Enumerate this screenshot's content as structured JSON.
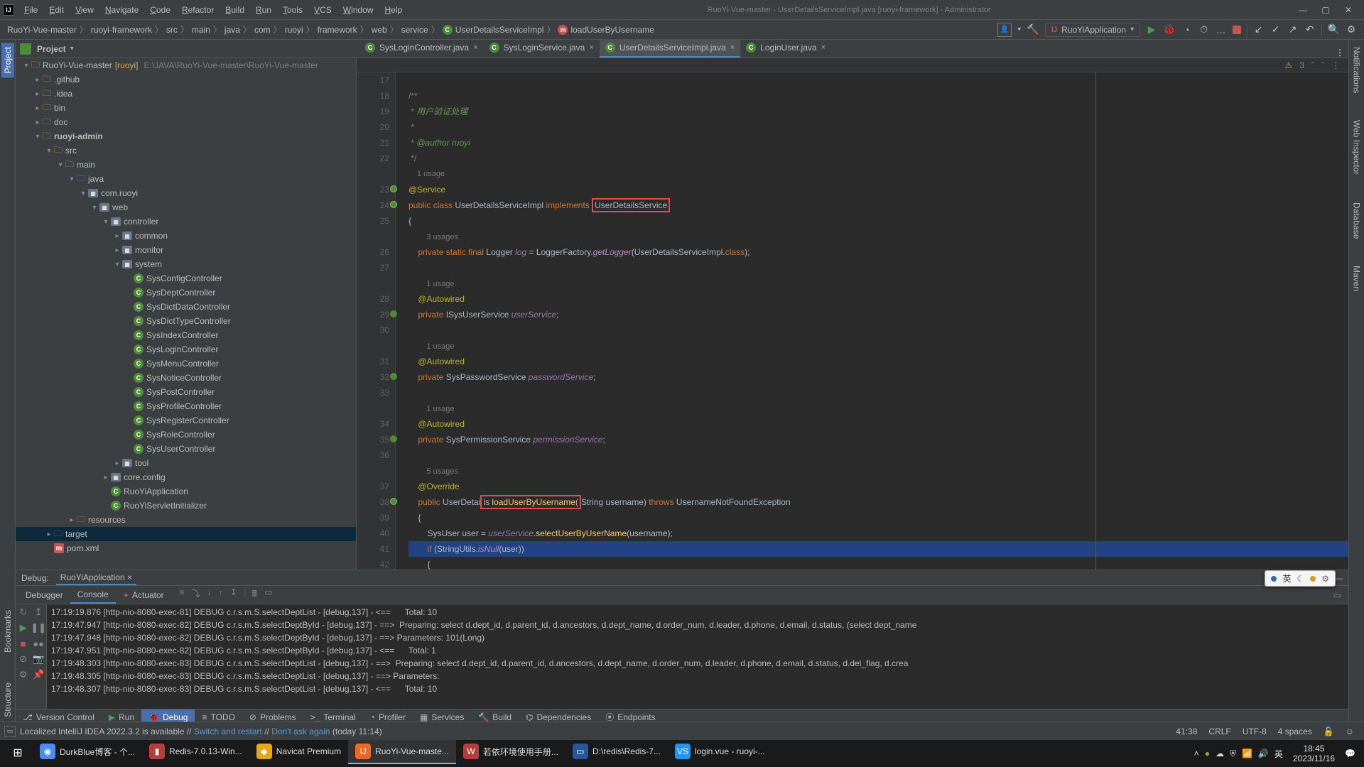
{
  "menu": {
    "items": [
      "File",
      "Edit",
      "View",
      "Navigate",
      "Code",
      "Refactor",
      "Build",
      "Run",
      "Tools",
      "VCS",
      "Window",
      "Help"
    ],
    "title_path": "RuoYi-Vue-master - UserDetailsServiceImpl.java [ruoyi-framework] - Administrator"
  },
  "breadcrumbs": [
    "RuoYi-Vue-master",
    "ruoyi-framework",
    "src",
    "main",
    "java",
    "com",
    "ruoyi",
    "framework",
    "web",
    "service",
    "UserDetailsServiceImpl",
    "loadUserByUsername"
  ],
  "run_config": "RuoYiApplication",
  "project_header": {
    "title": "Project"
  },
  "tree": [
    {
      "indent": 0,
      "arrow": "▾",
      "icon": "folder",
      "label": "RuoYi-Vue-master",
      "suffix": "[ruoyi]",
      "path": "E:\\JAVA\\RuoYi-Vue-master\\RuoYi-Vue-master"
    },
    {
      "indent": 1,
      "arrow": "▸",
      "icon": "folder",
      "label": ".github"
    },
    {
      "indent": 1,
      "arrow": "▸",
      "icon": "folder",
      "label": ".idea"
    },
    {
      "indent": 1,
      "arrow": "▸",
      "icon": "folder",
      "label": "bin"
    },
    {
      "indent": 1,
      "arrow": "▸",
      "icon": "folder",
      "label": "doc"
    },
    {
      "indent": 1,
      "arrow": "▾",
      "icon": "folder",
      "label": "ruoyi-admin",
      "bold": true
    },
    {
      "indent": 2,
      "arrow": "▾",
      "icon": "folder",
      "label": "src"
    },
    {
      "indent": 3,
      "arrow": "▾",
      "icon": "folder",
      "label": "main"
    },
    {
      "indent": 4,
      "arrow": "▾",
      "icon": "folder-blue",
      "label": "java"
    },
    {
      "indent": 5,
      "arrow": "▾",
      "icon": "pkg",
      "label": "com.ruoyi"
    },
    {
      "indent": 6,
      "arrow": "▾",
      "icon": "pkg",
      "label": "web"
    },
    {
      "indent": 7,
      "arrow": "▾",
      "icon": "pkg",
      "label": "controller"
    },
    {
      "indent": 8,
      "arrow": "▸",
      "icon": "pkg",
      "label": "common"
    },
    {
      "indent": 8,
      "arrow": "▸",
      "icon": "pkg",
      "label": "monitor"
    },
    {
      "indent": 8,
      "arrow": "▾",
      "icon": "pkg",
      "label": "system"
    },
    {
      "indent": 9,
      "arrow": "",
      "icon": "class",
      "label": "SysConfigController"
    },
    {
      "indent": 9,
      "arrow": "",
      "icon": "class",
      "label": "SysDeptController"
    },
    {
      "indent": 9,
      "arrow": "",
      "icon": "class",
      "label": "SysDictDataController"
    },
    {
      "indent": 9,
      "arrow": "",
      "icon": "class",
      "label": "SysDictTypeController"
    },
    {
      "indent": 9,
      "arrow": "",
      "icon": "class",
      "label": "SysIndexController"
    },
    {
      "indent": 9,
      "arrow": "",
      "icon": "class",
      "label": "SysLoginController"
    },
    {
      "indent": 9,
      "arrow": "",
      "icon": "class",
      "label": "SysMenuController"
    },
    {
      "indent": 9,
      "arrow": "",
      "icon": "class",
      "label": "SysNoticeController"
    },
    {
      "indent": 9,
      "arrow": "",
      "icon": "class",
      "label": "SysPostController"
    },
    {
      "indent": 9,
      "arrow": "",
      "icon": "class",
      "label": "SysProfileController"
    },
    {
      "indent": 9,
      "arrow": "",
      "icon": "class",
      "label": "SysRegisterController"
    },
    {
      "indent": 9,
      "arrow": "",
      "icon": "class",
      "label": "SysRoleController"
    },
    {
      "indent": 9,
      "arrow": "",
      "icon": "class",
      "label": "SysUserController"
    },
    {
      "indent": 8,
      "arrow": "▸",
      "icon": "pkg",
      "label": "tool"
    },
    {
      "indent": 7,
      "arrow": "▸",
      "icon": "pkg",
      "label": "core.config"
    },
    {
      "indent": 7,
      "arrow": "",
      "icon": "class",
      "label": "RuoYiApplication"
    },
    {
      "indent": 7,
      "arrow": "",
      "icon": "class",
      "label": "RuoYiServletInitializer"
    },
    {
      "indent": 4,
      "arrow": "▸",
      "icon": "folder",
      "label": "resources"
    },
    {
      "indent": 2,
      "arrow": "▸",
      "icon": "folder-red",
      "label": "target",
      "selected": true
    },
    {
      "indent": 2,
      "arrow": "",
      "icon": "m",
      "label": "pom.xml"
    }
  ],
  "tabs": [
    {
      "label": "SysLoginController.java",
      "active": false
    },
    {
      "label": "SysLoginService.java",
      "active": false
    },
    {
      "label": "UserDetailsServiceImpl.java",
      "active": true
    },
    {
      "label": "LoginUser.java",
      "active": false
    }
  ],
  "editor_status": {
    "warnings": "3",
    "marker": "^",
    "caret_up": "ˆ",
    "caret_down": "ˇ"
  },
  "code_lines": [
    {
      "n": 17,
      "html": ""
    },
    {
      "n": 18,
      "html": "<span class='comment'>/**</span>"
    },
    {
      "n": 19,
      "html": "<span class='comment'> * <span class='doc'>用户验证处理</span></span>"
    },
    {
      "n": 20,
      "html": "<span class='comment'> *</span>"
    },
    {
      "n": 21,
      "html": "<span class='comment'> * <span class='doc'>@author</span> <span class='doc'>ruoyi</span></span>"
    },
    {
      "n": 22,
      "html": "<span class='comment'> */</span>"
    },
    {
      "n": "",
      "html": "<span class='usage-hint'>1 usage</span>"
    },
    {
      "n": 23,
      "html": "<span class='ann'>@Service</span>",
      "mark": "impl"
    },
    {
      "n": 24,
      "html": "<span class='kw'>public class</span> <span class='type'>UserDetailsServiceImpl</span> <span class='kw'>implements</span> <span class='redbox'><span class='type'>UserDetailsService</span></span>",
      "mark": "impl"
    },
    {
      "n": 25,
      "html": "<span class='ident'>{</span>"
    },
    {
      "n": "",
      "html": "    <span class='usage-hint'>3 usages</span>"
    },
    {
      "n": 26,
      "html": "    <span class='kw'>private static final</span> <span class='type'>Logger</span> <span class='field'>log</span> = <span class='type'>LoggerFactory</span>.<span class='static-method'>getLogger</span>(<span class='type'>UserDetailsServiceImpl</span>.<span class='kw'>class</span>);"
    },
    {
      "n": 27,
      "html": ""
    },
    {
      "n": "",
      "html": "    <span class='usage-hint'>1 usage</span>"
    },
    {
      "n": 28,
      "html": "    <span class='ann'>@Autowired</span>"
    },
    {
      "n": 29,
      "html": "    <span class='kw'>private</span> <span class='type'>ISysUserService</span> <span class='field'>userService</span>;",
      "mark": "green"
    },
    {
      "n": 30,
      "html": ""
    },
    {
      "n": "",
      "html": "    <span class='usage-hint'>1 usage</span>"
    },
    {
      "n": 31,
      "html": "    <span class='ann'>@Autowired</span>"
    },
    {
      "n": 32,
      "html": "    <span class='kw'>private</span> <span class='type'>SysPasswordService</span> <span class='field'>passwordService</span>;",
      "mark": "green"
    },
    {
      "n": 33,
      "html": ""
    },
    {
      "n": "",
      "html": "    <span class='usage-hint'>1 usage</span>"
    },
    {
      "n": 34,
      "html": "    <span class='ann'>@Autowired</span>"
    },
    {
      "n": 35,
      "html": "    <span class='kw'>private</span> <span class='type'>SysPermissionService</span> <span class='field'>permissionService</span>;",
      "mark": "green"
    },
    {
      "n": 36,
      "html": ""
    },
    {
      "n": "",
      "html": "    <span class='usage-hint'>5 usages</span>"
    },
    {
      "n": 37,
      "html": "    <span class='ann'>@Override</span>"
    },
    {
      "n": 38,
      "html": "    <span class='kw'>public</span> <span class='type'>UserDetai</span><span class='redbox'><span class='type'>ls</span> <span class='method'>loadUserByUsername</span>(</span><span class='type'>String</span> <span class='ident'>username)</span> <span class='kw'>throws</span> <span class='type'>UsernameNotFoundException</span>",
      "mark": "impl"
    },
    {
      "n": 39,
      "html": "    <span class='ident'>{</span>"
    },
    {
      "n": 40,
      "html": "        <span class='type'>SysUser</span> <span class='ident'>user</span> = <span class='field'>userService</span>.<span class='method'>selectUserByUserName</span>(username);"
    },
    {
      "n": 41,
      "html": "        <span class='kw'>if</span> (<span class='type'>StringUtils</span>.<span class='static-method'>isNull</span>(user))",
      "current": true
    },
    {
      "n": 42,
      "html": "        <span class='ident'>{</span>"
    }
  ],
  "debug": {
    "title": "Debug:",
    "active_tab": "RuoYiApplication",
    "subtabs": [
      "Debugger",
      "Console",
      "Actuator"
    ],
    "active_subtab": "Console",
    "logs": [
      "17:19:19.876 [http-nio-8080-exec-81] DEBUG c.r.s.m.S.selectDeptList - [debug,137] - <==      Total: 10",
      "17:19:47.947 [http-nio-8080-exec-82] DEBUG c.r.s.m.S.selectDeptById - [debug,137] - ==>  Preparing: select d.dept_id, d.parent_id, d.ancestors, d.dept_name, d.order_num, d.leader, d.phone, d.email, d.status, (select dept_name",
      "17:19:47.948 [http-nio-8080-exec-82] DEBUG c.r.s.m.S.selectDeptById - [debug,137] - ==> Parameters: 101(Long)",
      "17:19:47.951 [http-nio-8080-exec-82] DEBUG c.r.s.m.S.selectDeptById - [debug,137] - <==      Total: 1",
      "17:19:48.303 [http-nio-8080-exec-83] DEBUG c.r.s.m.S.selectDeptList - [debug,137] - ==>  Preparing: select d.dept_id, d.parent_id, d.ancestors, d.dept_name, d.order_num, d.leader, d.phone, d.email, d.status, d.del_flag, d.crea",
      "17:19:48.305 [http-nio-8080-exec-83] DEBUG c.r.s.m.S.selectDeptList - [debug,137] - ==> Parameters:",
      "17:19:48.307 [http-nio-8080-exec-83] DEBUG c.r.s.m.S.selectDeptList - [debug,137] - <==      Total: 10"
    ]
  },
  "bottom_tools": [
    {
      "label": "Version Control",
      "icon": "⎇"
    },
    {
      "label": "Run",
      "icon": "▶",
      "iconcls": "green"
    },
    {
      "label": "Debug",
      "icon": "🐞",
      "active": true
    },
    {
      "label": "TODO",
      "icon": "≡"
    },
    {
      "label": "Problems",
      "icon": "⊘"
    },
    {
      "label": "Terminal",
      "icon": ">_"
    },
    {
      "label": "Profiler",
      "icon": "◔"
    },
    {
      "label": "Services",
      "icon": "▦"
    },
    {
      "label": "Build",
      "icon": "🔨"
    },
    {
      "label": "Dependencies",
      "icon": "⌬"
    },
    {
      "label": "Endpoints",
      "icon": "⦿"
    }
  ],
  "status": {
    "message_prefix": "Localized IntelliJ IDEA 2022.3.2 is available // ",
    "link1": "Switch and restart",
    "sep": " // ",
    "link2": "Don't ask again",
    "suffix": " (today 11:14)",
    "caret": "41:38",
    "eol": "CRLF",
    "encoding": "UTF-8",
    "indent": "4 spaces"
  },
  "overlay": {
    "lang": "英"
  },
  "taskbar": {
    "items": [
      {
        "label": "",
        "icon": "⊞",
        "cls": "start"
      },
      {
        "label": "DurkBlue博客 - 个...",
        "iconbg": "#4c8bf5",
        "icontext": "◉"
      },
      {
        "label": "Redis-7.0.13-Win...",
        "iconbg": "#b93c3c",
        "icontext": "▮"
      },
      {
        "label": "Navicat Premium",
        "iconbg": "#e6a817",
        "icontext": "◆"
      },
      {
        "label": "RuoYi-Vue-maste...",
        "iconbg": "#f26522",
        "icontext": "IJ",
        "active": true
      },
      {
        "label": "若依环境使用手册...",
        "iconbg": "#b93c3c",
        "icontext": "W"
      },
      {
        "label": "D:\\redis\\Redis-7...",
        "iconbg": "#2a579a",
        "icontext": "▭"
      },
      {
        "label": "login.vue - ruoyi-...",
        "iconbg": "#2396f3",
        "icontext": "VS"
      }
    ],
    "tray_time": "18:45",
    "tray_date": "2023/11/16",
    "ime": "英"
  },
  "left_tabs": [
    "Project",
    "Bookmarks",
    "Structure"
  ],
  "right_tabs": [
    "Notifications",
    "Web Inspector",
    "Database",
    "Maven"
  ]
}
